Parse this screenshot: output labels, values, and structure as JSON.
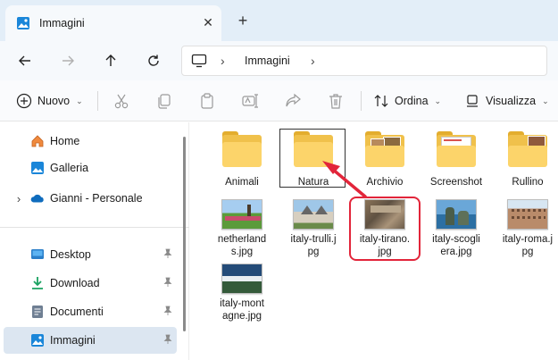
{
  "window": {
    "tab_title": "Immagini",
    "close_glyph": "✕",
    "new_tab_glyph": "+"
  },
  "nav": {
    "back_icon": "arrow-left-icon",
    "forward_icon": "arrow-right-icon",
    "up_icon": "arrow-up-icon",
    "refresh_icon": "refresh-icon",
    "breadcrumb": [
      "Immagini"
    ],
    "chevron_glyph": "›"
  },
  "toolbar": {
    "new_label": "Nuovo",
    "sort_label": "Ordina",
    "view_label": "Visualizza",
    "more_glyph": "···",
    "dropdown_glyph": "⌄"
  },
  "sidebar": {
    "top_items": [
      {
        "label": "Home",
        "icon": "home-icon"
      },
      {
        "label": "Galleria",
        "icon": "gallery-icon"
      },
      {
        "label": "Gianni - Personale",
        "icon": "onedrive-icon",
        "expander": "›"
      }
    ],
    "pinned_items": [
      {
        "label": "Desktop",
        "icon": "desktop-icon"
      },
      {
        "label": "Download",
        "icon": "download-icon"
      },
      {
        "label": "Documenti",
        "icon": "documents-icon"
      },
      {
        "label": "Immagini",
        "icon": "pictures-icon",
        "selected": true
      }
    ]
  },
  "files": {
    "folders": [
      {
        "name": "Animali"
      },
      {
        "name": "Natura"
      },
      {
        "name": "Archivio"
      },
      {
        "name": "Screenshot"
      },
      {
        "name": "Rullino"
      }
    ],
    "images": [
      {
        "line1": "netherland",
        "line2": "s.jpg"
      },
      {
        "line1": "italy-trulli.j",
        "line2": "pg"
      },
      {
        "line1": "italy-tirano.",
        "line2": "jpg"
      },
      {
        "line1": "italy-scogli",
        "line2": "era.jpg"
      },
      {
        "line1": "italy-roma.j",
        "line2": "pg"
      },
      {
        "line1": "italy-mont",
        "line2": "agne.jpg"
      }
    ]
  },
  "colors": {
    "accent": "#0067c0",
    "annotation_red": "#e2253a",
    "folder_yellow": "#fcd46a"
  }
}
